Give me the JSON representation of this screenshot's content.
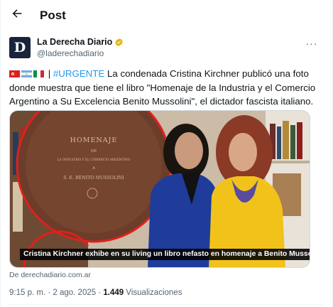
{
  "header": {
    "title": "Post",
    "back_icon": "arrow-left-icon"
  },
  "post": {
    "author_name": "La Derecha Diario",
    "author_handle": "@laderechadiario",
    "avatar_letter": "D",
    "verified_color": "#e2b719",
    "more_icon": "more-horizontal-icon",
    "more_glyph": "···",
    "flags": [
      "argentina-flag",
      "italy-flag"
    ],
    "hashtag": "#URGENTE",
    "separator": "|",
    "text": "La condenada Cristina Kirchner publicó una foto donde muestra que tiene el libro \"Homenaje de la Industria y el Comercio Argentino a Su Excelencia Benito Mussolini\", el dictador fascista italiano.",
    "media": {
      "caption": "Cristina Kirchner exhibe en su living un libro nefasto en homenaje a Benito Mussolini",
      "book_lines": [
        "HOMENAJE",
        "DE",
        "LA INDUSTRIA Y EL COMERCIO ARGENTINO",
        "A",
        "S. E. BENITO MUSSOLINI"
      ]
    },
    "source": "De derechadiario.com.ar",
    "time": "9:15 p. m.",
    "dot": "·",
    "date": "2 ago. 2025",
    "views_count": "1.449",
    "views_label": "Visualizaciones"
  },
  "colors": {
    "accent": "#1d9bf0",
    "muted": "#536471",
    "text": "#0f1419",
    "highlight_circle": "#e0201b"
  }
}
